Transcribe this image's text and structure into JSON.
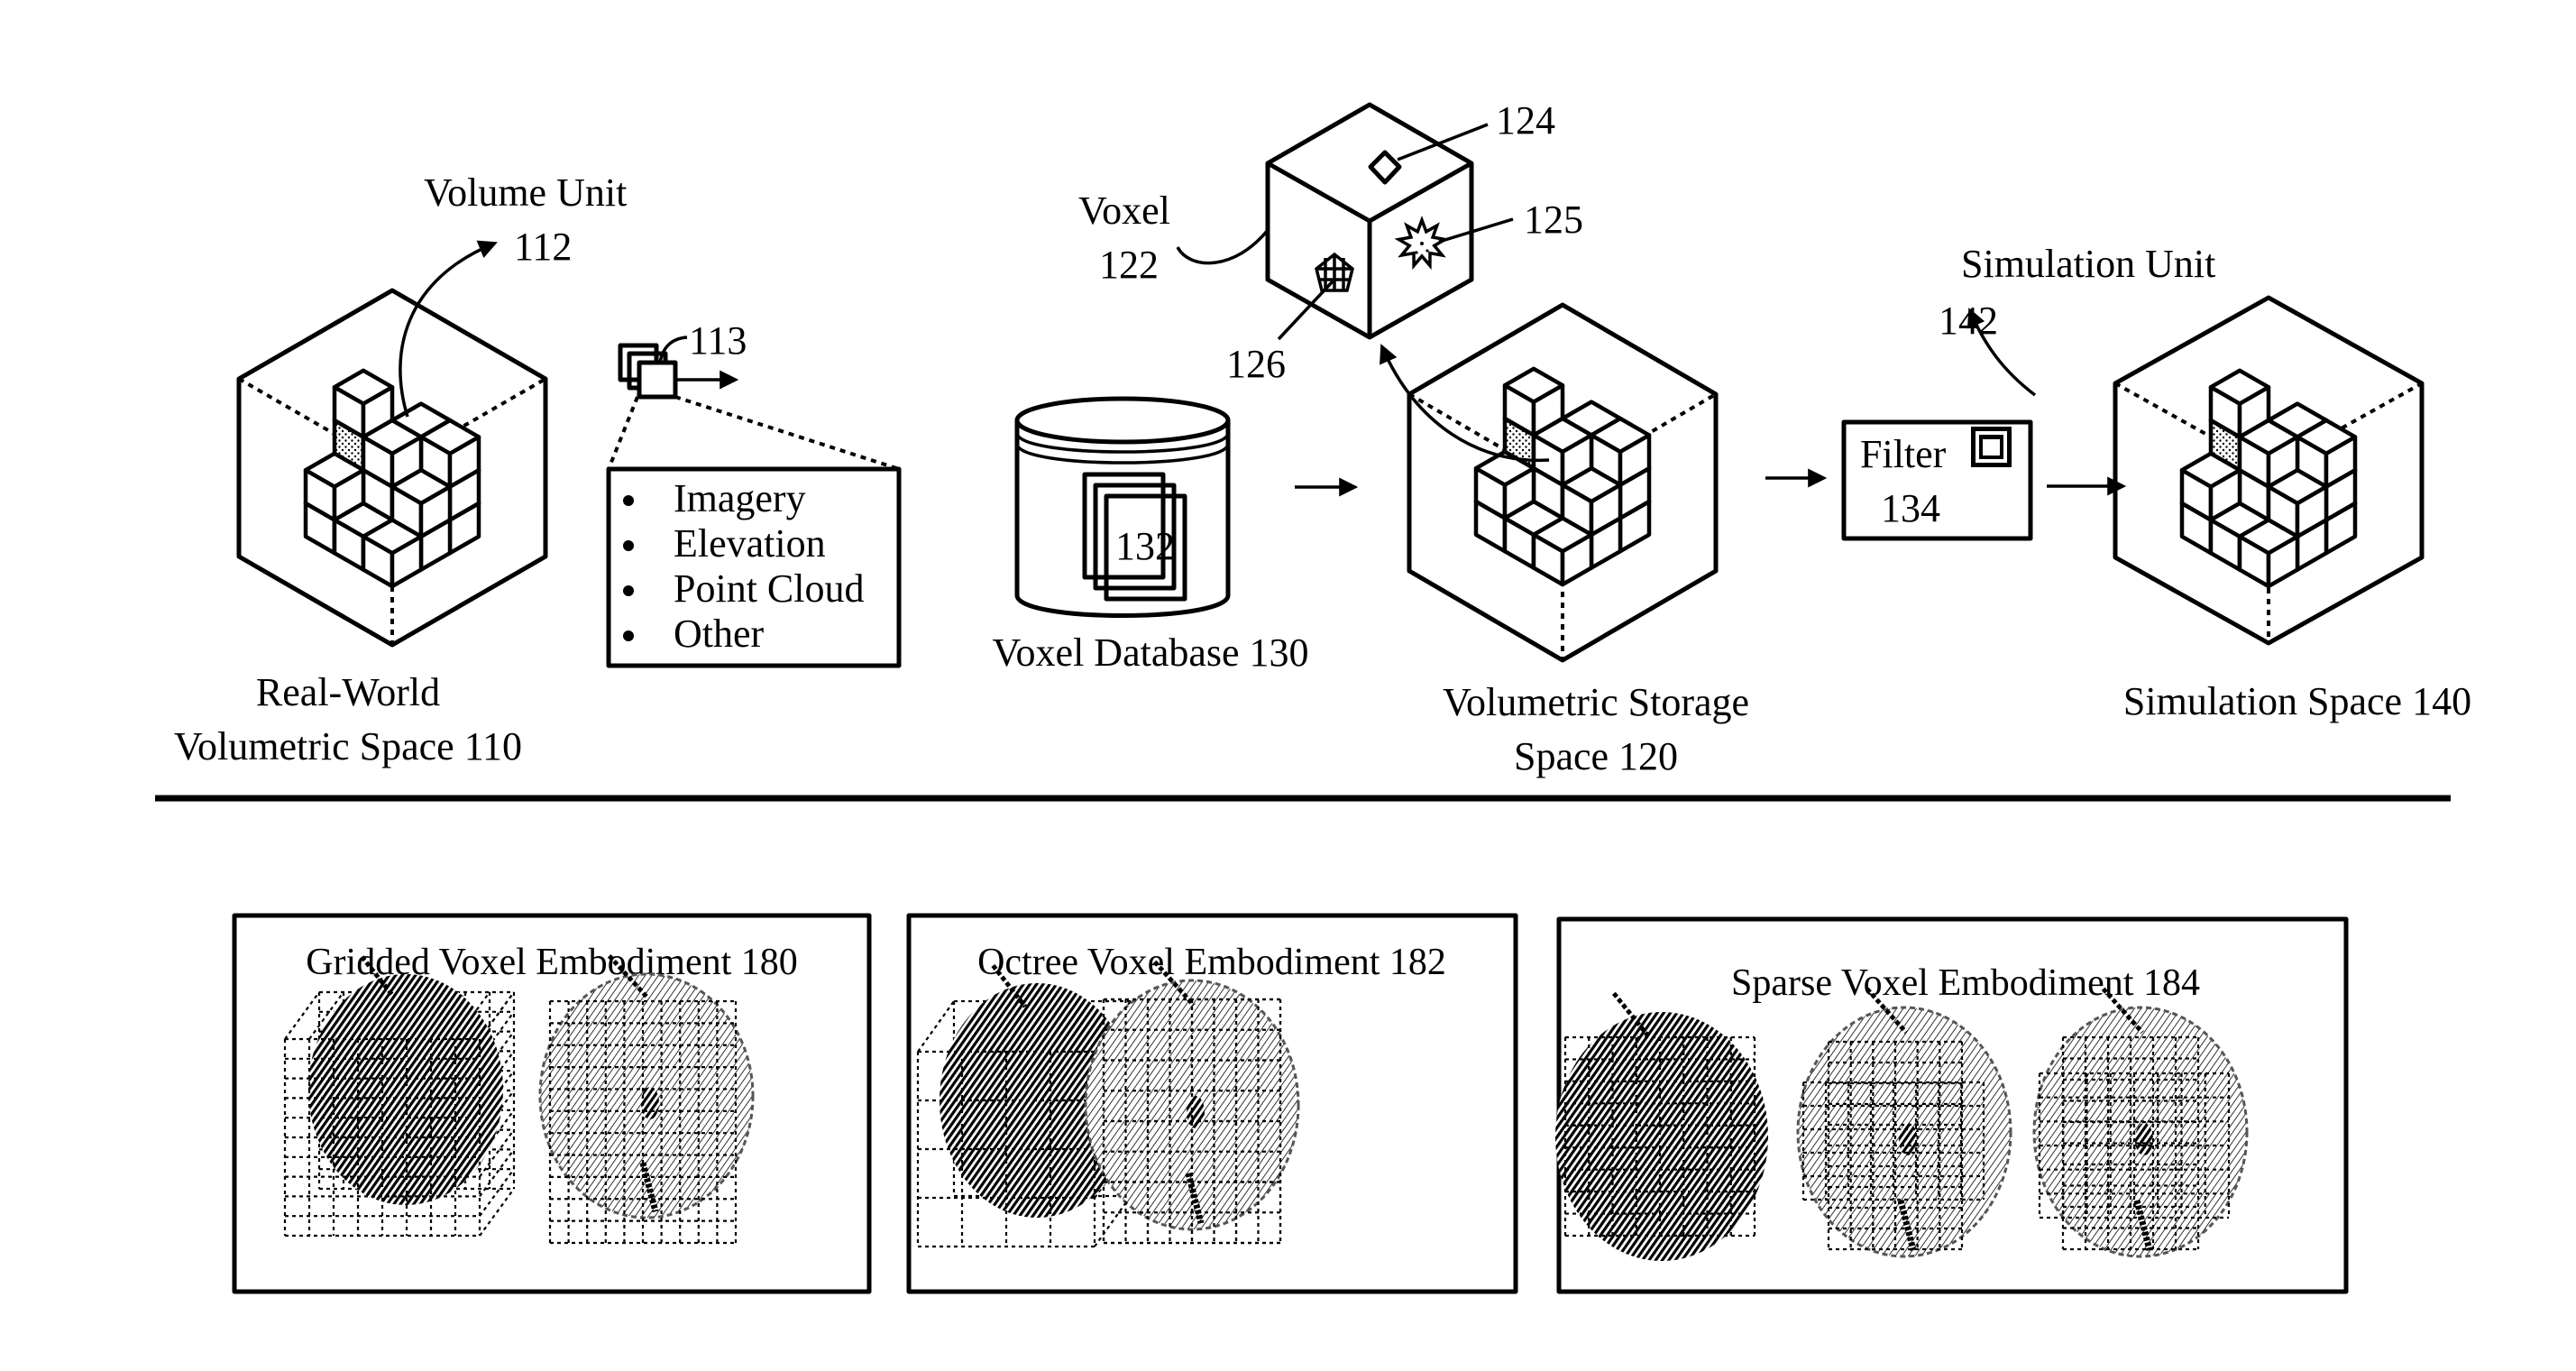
{
  "figure": {
    "top_section": {
      "real_world_space": {
        "label_line1": "Real-World",
        "label_line2": "Volumetric Space 110",
        "volume_unit_label": "Volume Unit",
        "volume_unit_ref": "112",
        "sensor_ref": "113",
        "sensor_data_types": [
          "Imagery",
          "Elevation",
          "Point Cloud",
          "Other"
        ]
      },
      "voxel_database": {
        "label": "Voxel Database 130",
        "records_ref": "132"
      },
      "voxel": {
        "label": "Voxel",
        "ref": "122",
        "attribute_refs": {
          "top_face_marker": "124",
          "right_face_marker": "125",
          "left_face_marker": "126"
        }
      },
      "volumetric_storage_space": {
        "label_line1": "Volumetric Storage",
        "label_line2": "Space 120"
      },
      "filter": {
        "label": "Filter",
        "ref": "134"
      },
      "simulation_space": {
        "label": "Simulation Space 140",
        "unit_label": "Simulation Unit",
        "unit_ref": "142"
      }
    },
    "bottom_section": {
      "panels": [
        {
          "title": "Gridded Voxel Embodiment 180",
          "kind": "gridded"
        },
        {
          "title": "Octree Voxel Embodiment 182",
          "kind": "octree"
        },
        {
          "title": "Sparse Voxel Embodiment 184",
          "kind": "sparse"
        }
      ]
    }
  }
}
